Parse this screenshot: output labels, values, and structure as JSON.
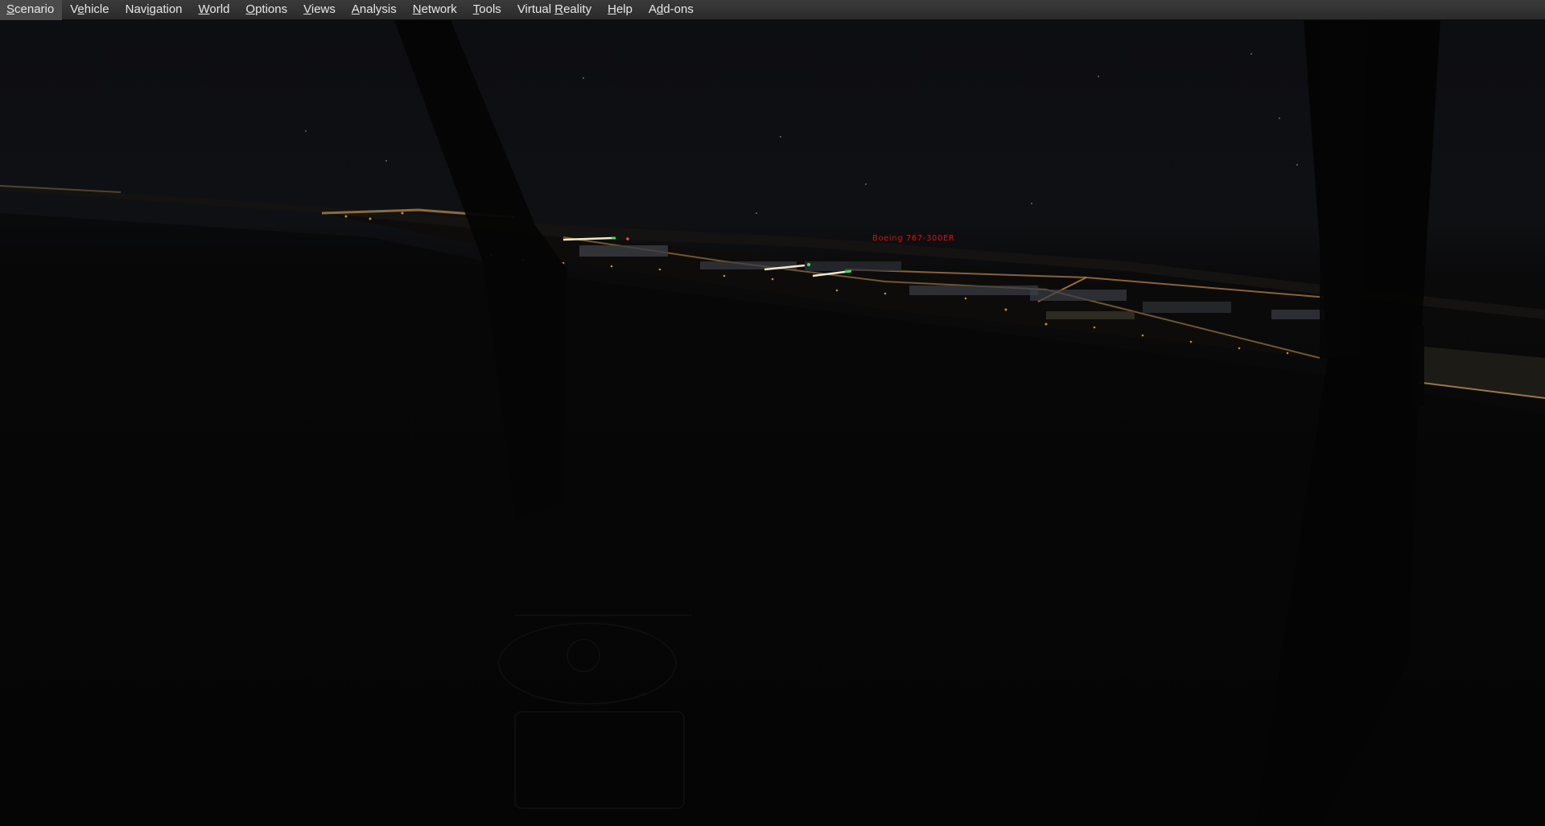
{
  "window": {
    "menu": [
      {
        "id": "scenario",
        "label": "Scenario",
        "accel": 0
      },
      {
        "id": "vehicle",
        "label": "Vehicle",
        "accel": 1
      },
      {
        "id": "navigation",
        "label": "Navigation",
        "accel": 3
      },
      {
        "id": "world",
        "label": "World",
        "accel": 0
      },
      {
        "id": "options",
        "label": "Options",
        "accel": 0
      },
      {
        "id": "views",
        "label": "Views",
        "accel": 0
      },
      {
        "id": "analysis",
        "label": "Analysis",
        "accel": 0
      },
      {
        "id": "network",
        "label": "Network",
        "accel": 0
      },
      {
        "id": "tools",
        "label": "Tools",
        "accel": 0
      },
      {
        "id": "virtual-reality",
        "label": "Virtual Reality",
        "accel": 8
      },
      {
        "id": "help",
        "label": "Help",
        "accel": 0
      },
      {
        "id": "add-ons",
        "label": "Add-ons",
        "accel": 1
      }
    ]
  },
  "scene": {
    "aircraft_label": "Boeing 767-300ER",
    "aircraft_label_color": "#c01818",
    "sky_color": "#0c0d10",
    "ground_color": "#050505",
    "city_light_color": "#d9a24a",
    "runway_light_color": "#f3e7c8",
    "green_light_color": "#3ddc7a"
  }
}
